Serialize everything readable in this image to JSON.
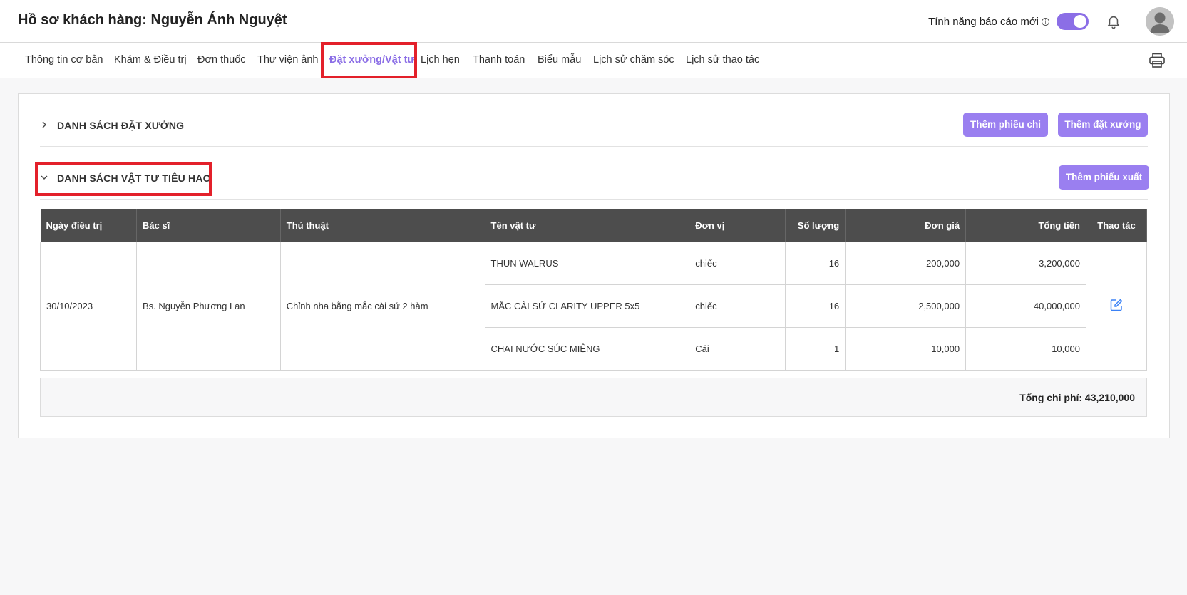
{
  "header": {
    "title": "Hồ sơ khách hàng: Nguyễn Ánh Nguyệt",
    "feature_label": "Tính năng báo cáo mới",
    "info_glyph": "i",
    "toggle_on": true,
    "accent_color": "#8b6ee6"
  },
  "tabs": [
    {
      "label": "Thông tin cơ bản"
    },
    {
      "label": "Khám & Điều trị"
    },
    {
      "label": "Đơn thuốc"
    },
    {
      "label": "Thư viện ảnh"
    },
    {
      "label": "Đặt xưởng/Vật tư",
      "active": true
    },
    {
      "label": "Lịch hẹn"
    },
    {
      "label": "Thanh toán"
    },
    {
      "label": "Biểu mẫu"
    },
    {
      "label": "Lịch sử chăm sóc"
    },
    {
      "label": "Lịch sử thao tác"
    }
  ],
  "sections": {
    "workshop": {
      "title": "DANH SÁCH ĐẶT XƯỞNG",
      "expanded": false,
      "btn_add_expense": "Thêm phiếu chi",
      "btn_add_order": "Thêm đặt xưởng"
    },
    "supplies": {
      "title": "DANH SÁCH VẬT TƯ TIÊU HAO",
      "expanded": true,
      "btn_add_export": "Thêm phiếu xuất"
    }
  },
  "table": {
    "headers": {
      "date": "Ngày điều trị",
      "doctor": "Bác sĩ",
      "procedure": "Thủ thuật",
      "item": "Tên vật tư",
      "unit": "Đơn vị",
      "qty": "Số lượng",
      "price": "Đơn giá",
      "total": "Tổng tiền",
      "action": "Thao tác"
    },
    "group": {
      "date": "30/10/2023",
      "doctor": "Bs. Nguyễn Phương Lan",
      "procedure": "Chỉnh nha bằng mắc cài sứ 2 hàm"
    },
    "rows": [
      {
        "item": "THUN WALRUS",
        "unit": "chiếc",
        "qty": "16",
        "price": "200,000",
        "total": "3,200,000"
      },
      {
        "item": "MẮC CÀI SỨ CLARITY UPPER 5x5",
        "unit": "chiếc",
        "qty": "16",
        "price": "2,500,000",
        "total": "40,000,000"
      },
      {
        "item": "CHAI NƯỚC SÚC MIỆNG",
        "unit": "Cái",
        "qty": "1",
        "price": "10,000",
        "total": "10,000"
      }
    ],
    "total_label": "Tổng chi phí: 43,210,000"
  },
  "icons": {
    "bell": "bell-icon",
    "avatar": "user-avatar",
    "print": "printer-icon",
    "edit": "edit-icon",
    "chevron_right": "chevron-right-icon",
    "chevron_down": "chevron-down-icon"
  }
}
